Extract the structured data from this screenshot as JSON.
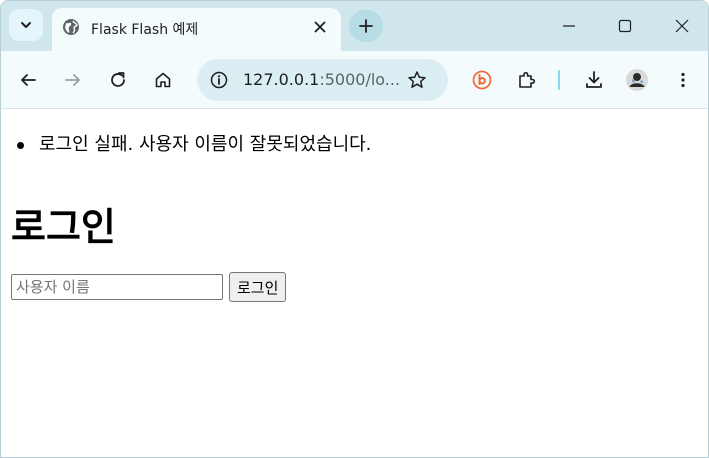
{
  "browser": {
    "tab": {
      "title": "Flask Flash 예제",
      "favicon": "globe-icon"
    },
    "address_bar": {
      "url_host": "127.0.0.1",
      "url_rest": ":5000/lo..."
    },
    "icons": {
      "tab_search": "chevron-down-icon",
      "close_tab": "close-icon",
      "new_tab": "plus-icon",
      "minimize": "minimize-icon",
      "maximize": "maximize-icon",
      "close_window": "close-icon",
      "back": "back-arrow-icon",
      "forward": "forward-arrow-icon",
      "reload": "reload-icon",
      "home": "home-icon",
      "site_info": "info-icon",
      "bookmark": "star-icon",
      "extension_b": "bitwarden-icon",
      "extensions": "puzzle-icon",
      "downloads": "download-icon",
      "profile": "avatar-icon",
      "menu": "more-vertical-icon"
    },
    "colors": {
      "tabstrip": "#cfe6ec",
      "toolbar": "#f3fbfd",
      "omnibox": "#daeef3",
      "accent": "#8ad7ef"
    }
  },
  "page": {
    "flash_messages": [
      "로그인 실패. 사용자 이름이 잘못되었습니다."
    ],
    "title": "로그인",
    "form": {
      "username_placeholder": "사용자 이름",
      "username_value": "",
      "submit_label": "로그인"
    }
  }
}
